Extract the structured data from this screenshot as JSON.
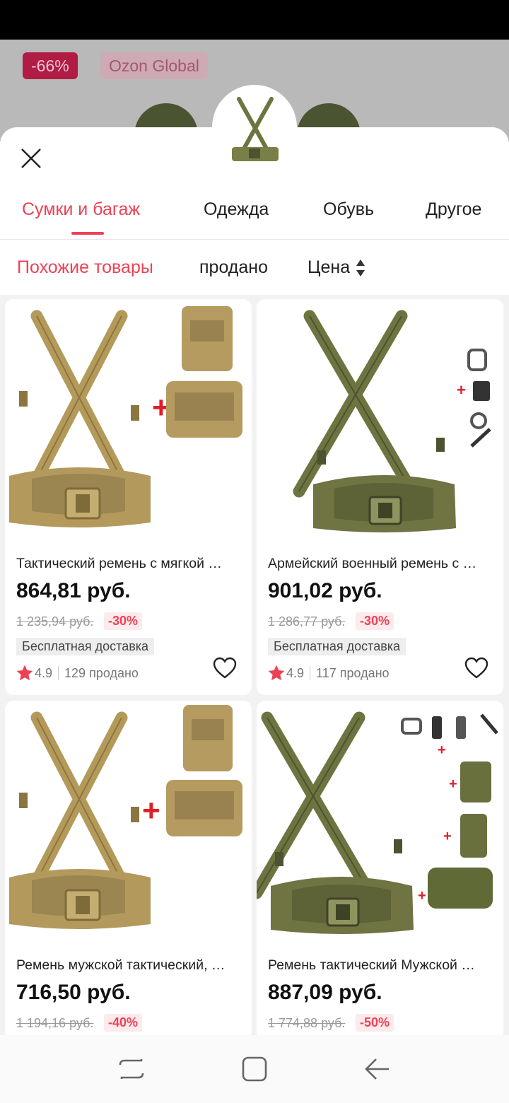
{
  "background": {
    "discount_badge": "-66%",
    "store_badge": "Ozon Global"
  },
  "tabs": [
    {
      "label": "Сумки и багаж",
      "active": true
    },
    {
      "label": "Одежда",
      "active": false
    },
    {
      "label": "Обувь",
      "active": false
    },
    {
      "label": "Другое",
      "active": false
    }
  ],
  "filters": {
    "similar": "Похожие товары",
    "sold": "продано",
    "price": "Цена"
  },
  "products": [
    {
      "title": "Тактический ремень с мягкой …",
      "price": "864,81 руб.",
      "old_price": "1 235,94 руб.",
      "discount": "-30%",
      "shipping": "Бесплатная доставка",
      "rating": "4.9",
      "sold": "129 продано"
    },
    {
      "title": "Армейский военный ремень с …",
      "price": "901,02 руб.",
      "old_price": "1 286,77 руб.",
      "discount": "-30%",
      "shipping": "Бесплатная доставка",
      "rating": "4.9",
      "sold": "117 продано"
    },
    {
      "title": "Ремень мужской тактический, …",
      "price": "716,50 руб.",
      "old_price": "1 194,16 руб.",
      "discount": "-40%"
    },
    {
      "title": "Ремень тактический Мужской …",
      "price": "887,09 руб.",
      "old_price": "1 774,88 руб.",
      "discount": "-50%"
    }
  ],
  "colors": {
    "accent": "#ee4155",
    "khaki": "#b49a5a",
    "olive": "#6e7440"
  }
}
